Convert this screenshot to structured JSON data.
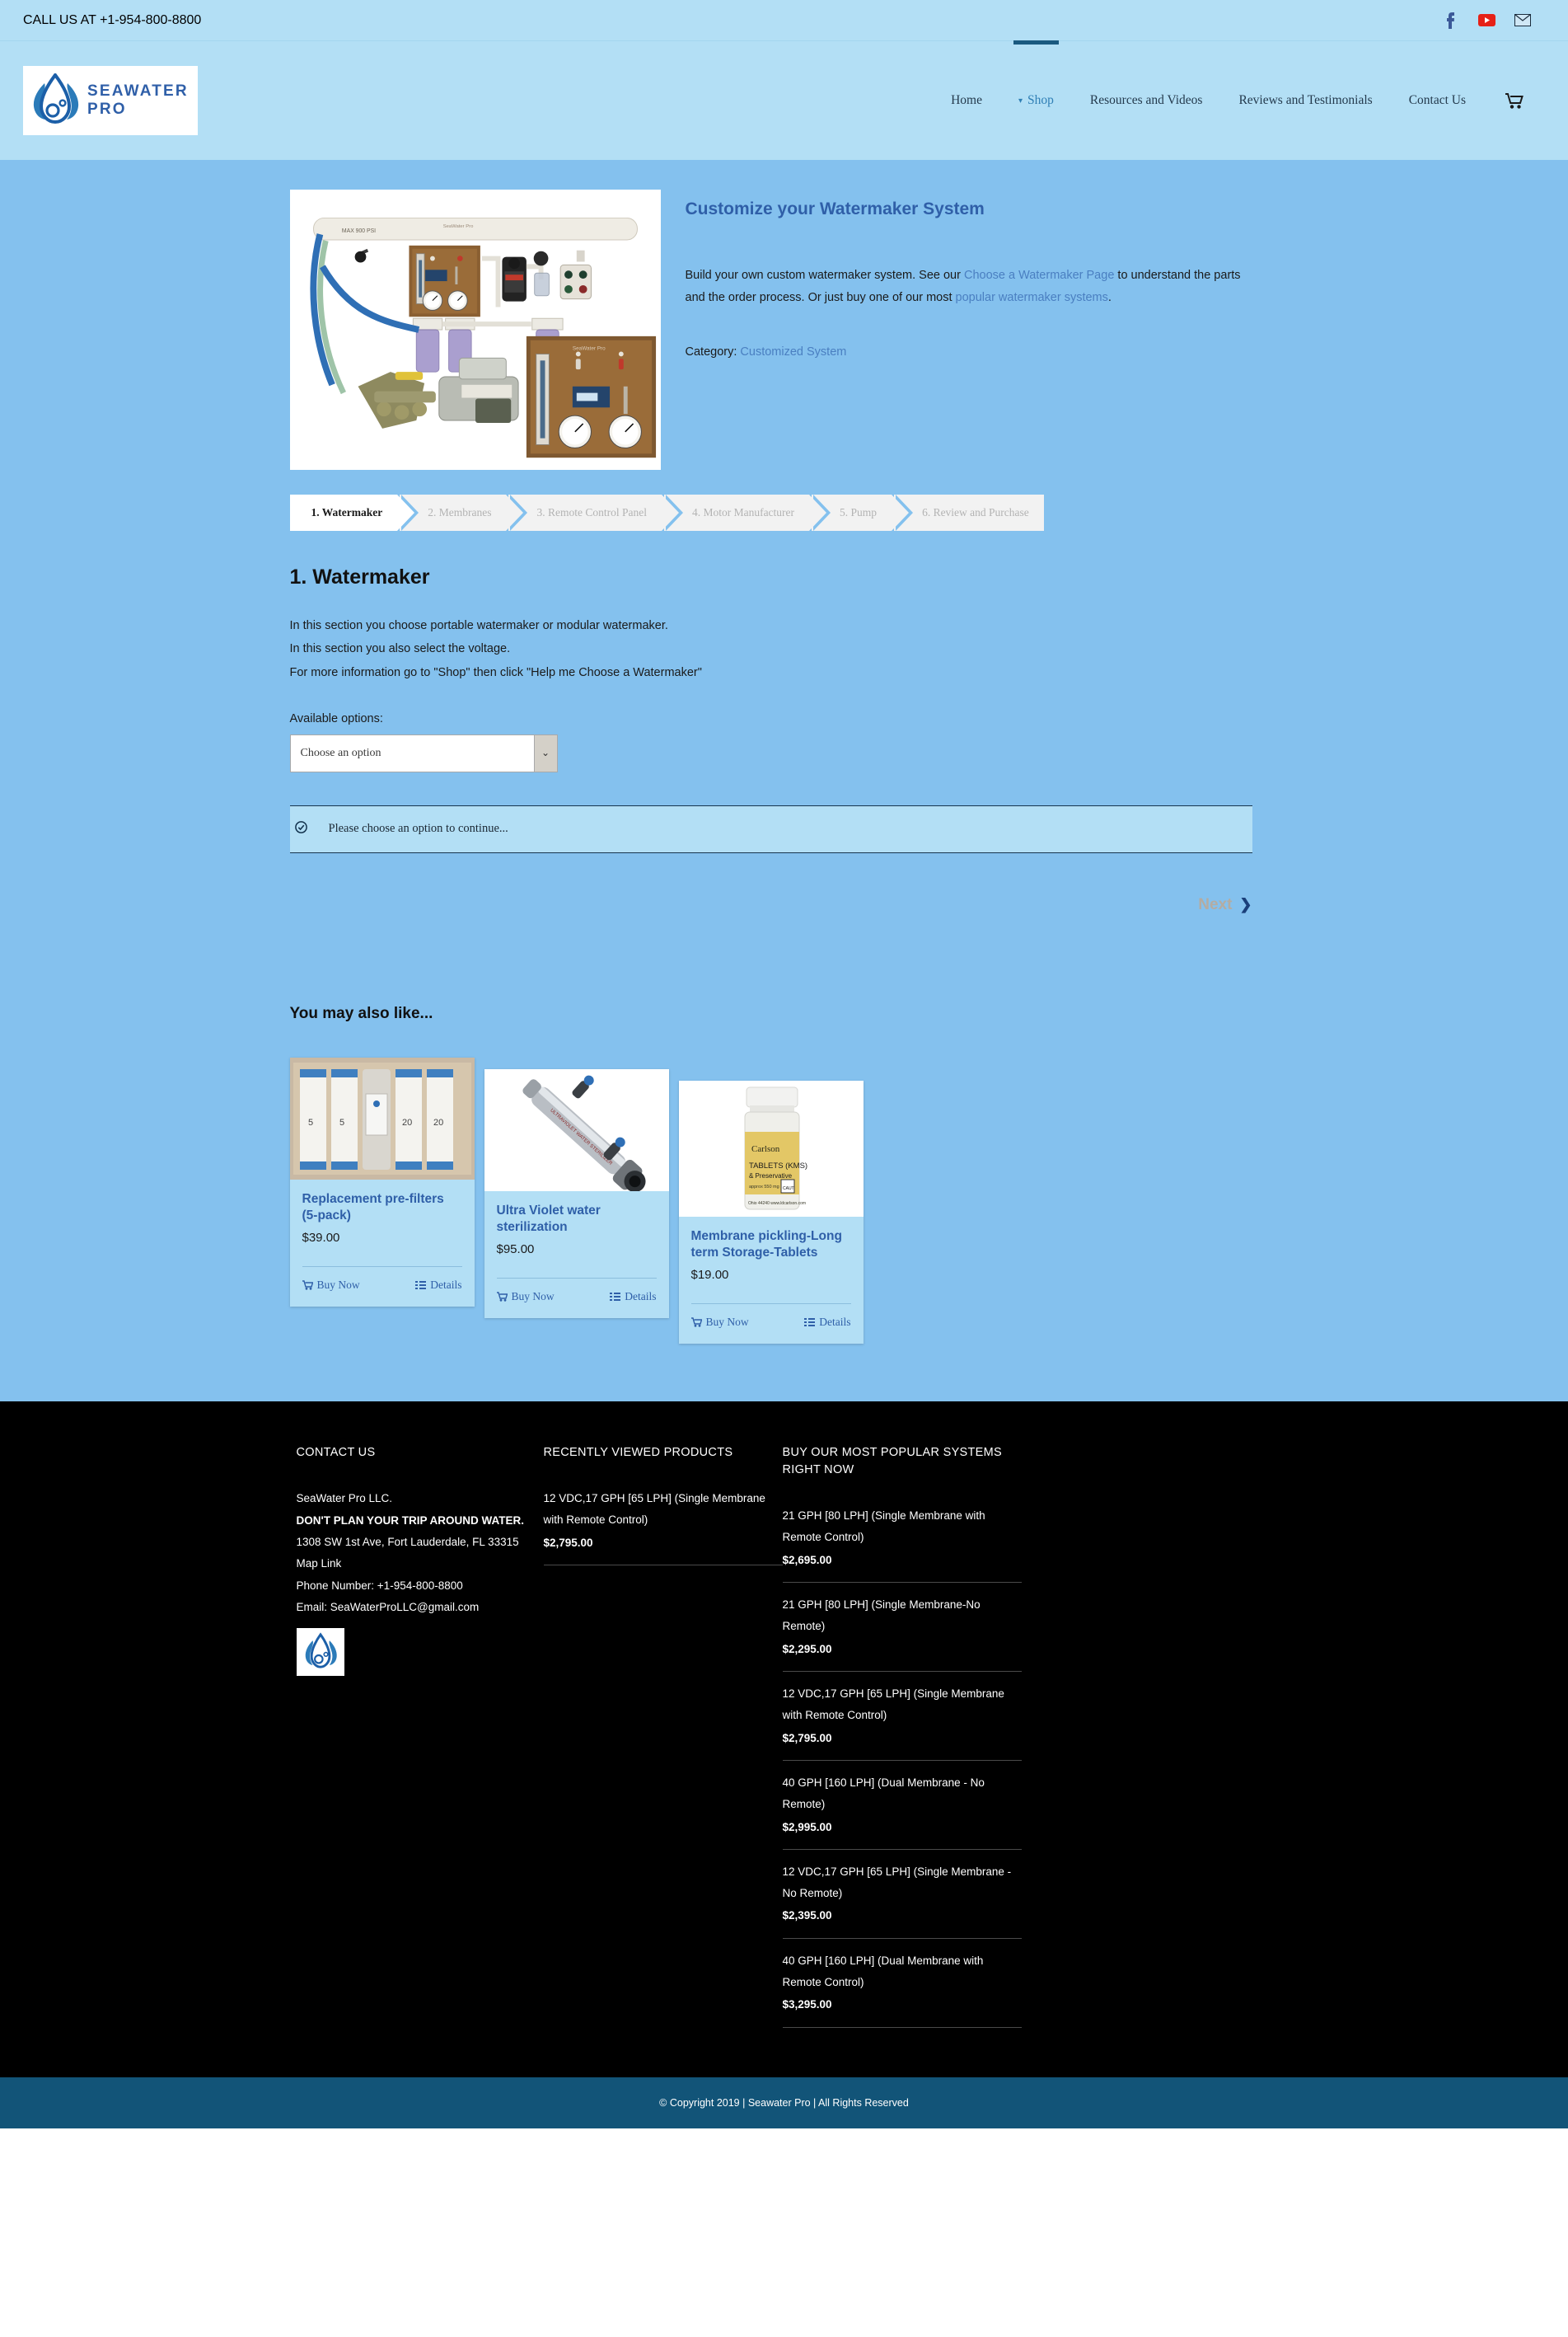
{
  "topbar": {
    "phone": "CALL US AT +1-954-800-8800",
    "social": [
      "facebook-icon",
      "youtube-icon",
      "email-icon"
    ]
  },
  "header": {
    "logo_text": "SEAWATER PRO",
    "nav": [
      {
        "label": "Home",
        "active": false,
        "caret": false
      },
      {
        "label": "Shop",
        "active": true,
        "caret": true
      },
      {
        "label": "Resources and Videos",
        "active": false,
        "caret": false
      },
      {
        "label": "Reviews and Testimonials",
        "active": false,
        "caret": false
      },
      {
        "label": "Contact Us",
        "active": false,
        "caret": false
      }
    ],
    "cart_icon": "shopping-cart-icon"
  },
  "product": {
    "title": "Customize your Watermaker System",
    "desc_1": "Build your own custom watermaker system. See our ",
    "desc_link_1": "Choose a Watermaker Page",
    "desc_2": " to understand the parts and the order process. Or just buy one of our most ",
    "desc_link_2": "popular watermaker systems",
    "desc_3": ".",
    "category_label": "Category: ",
    "category_value": "Customized System"
  },
  "steps": [
    {
      "label": "1. Watermaker",
      "current": true
    },
    {
      "label": "2. Membranes",
      "current": false
    },
    {
      "label": "3. Remote Control Panel",
      "current": false
    },
    {
      "label": "4. Motor Manufacturer",
      "current": false
    },
    {
      "label": "5. Pump",
      "current": false
    },
    {
      "label": "6. Review and Purchase",
      "current": false
    }
  ],
  "step_content": {
    "heading": "1. Watermaker",
    "lines": [
      "In this section you choose portable watermaker or modular watermaker.",
      "In this section you also select the voltage.",
      "For more information go to \"Shop\" then click \"Help me Choose a Watermaker\""
    ],
    "available_label": "Available options:",
    "select_value": "Choose an option",
    "select_placeholder": "Choose an option",
    "notice_text": "Please choose an option to continue...",
    "notice_icon": "check-circle-icon",
    "next_label": "Next"
  },
  "related": {
    "heading": "You may also like...",
    "buy_label": "Buy Now",
    "details_label": "Details",
    "items": [
      {
        "title": "Replacement pre-filters (5-pack)",
        "price": "$39.00",
        "image": "prefilters"
      },
      {
        "title": "Ultra Violet water sterilization",
        "price": "$95.00",
        "image": "uv-sterilizer"
      },
      {
        "title": "Membrane pickling-Long term Storage-Tablets",
        "price": "$19.00",
        "image": "tablet-bottle"
      }
    ]
  },
  "footer": {
    "contact": {
      "head": "CONTACT US",
      "company": "SeaWater Pro LLC.",
      "slogan": "DON'T PLAN YOUR TRIP AROUND WATER.",
      "address": "1308 SW 1st Ave, Fort Lauderdale, FL 33315",
      "map_link": "Map Link",
      "phone": "Phone Number: +1-954-800-8800",
      "email": "Email: SeaWaterProLLC@gmail.com"
    },
    "recently_viewed": {
      "head": "RECENTLY VIEWED PRODUCTS",
      "items": [
        {
          "name": "12 VDC,17 GPH [65 LPH] (Single Membrane with Remote Control)",
          "price": "$2,795.00"
        }
      ]
    },
    "popular": {
      "head": "BUY OUR MOST POPULAR SYSTEMS RIGHT NOW",
      "items": [
        {
          "name": "21 GPH [80 LPH] (Single Membrane with Remote Control)",
          "price": "$2,695.00"
        },
        {
          "name": "21 GPH [80 LPH] (Single Membrane-No Remote)",
          "price": "$2,295.00"
        },
        {
          "name": "12 VDC,17 GPH [65 LPH] (Single Membrane with Remote Control)",
          "price": "$2,795.00"
        },
        {
          "name": "40 GPH [160 LPH] (Dual Membrane - No Remote)",
          "price": "$2,995.00"
        },
        {
          "name": "12 VDC,17 GPH [65 LPH] (Single Membrane - No Remote)",
          "price": "$2,395.00"
        },
        {
          "name": "40 GPH [160 LPH] (Dual Membrane with Remote Control)",
          "price": "$3,295.00"
        }
      ]
    },
    "copyright": "© Copyright 2019 | Seawater Pro | All Rights Reserved"
  },
  "colors": {
    "topbar_bg": "#b3dff5",
    "main_bg": "#84c1ee",
    "accent_blue": "#2f5fa8",
    "link_blue": "#4a7fc1",
    "footer_bg": "#000000",
    "copyright_bg": "#125478"
  }
}
